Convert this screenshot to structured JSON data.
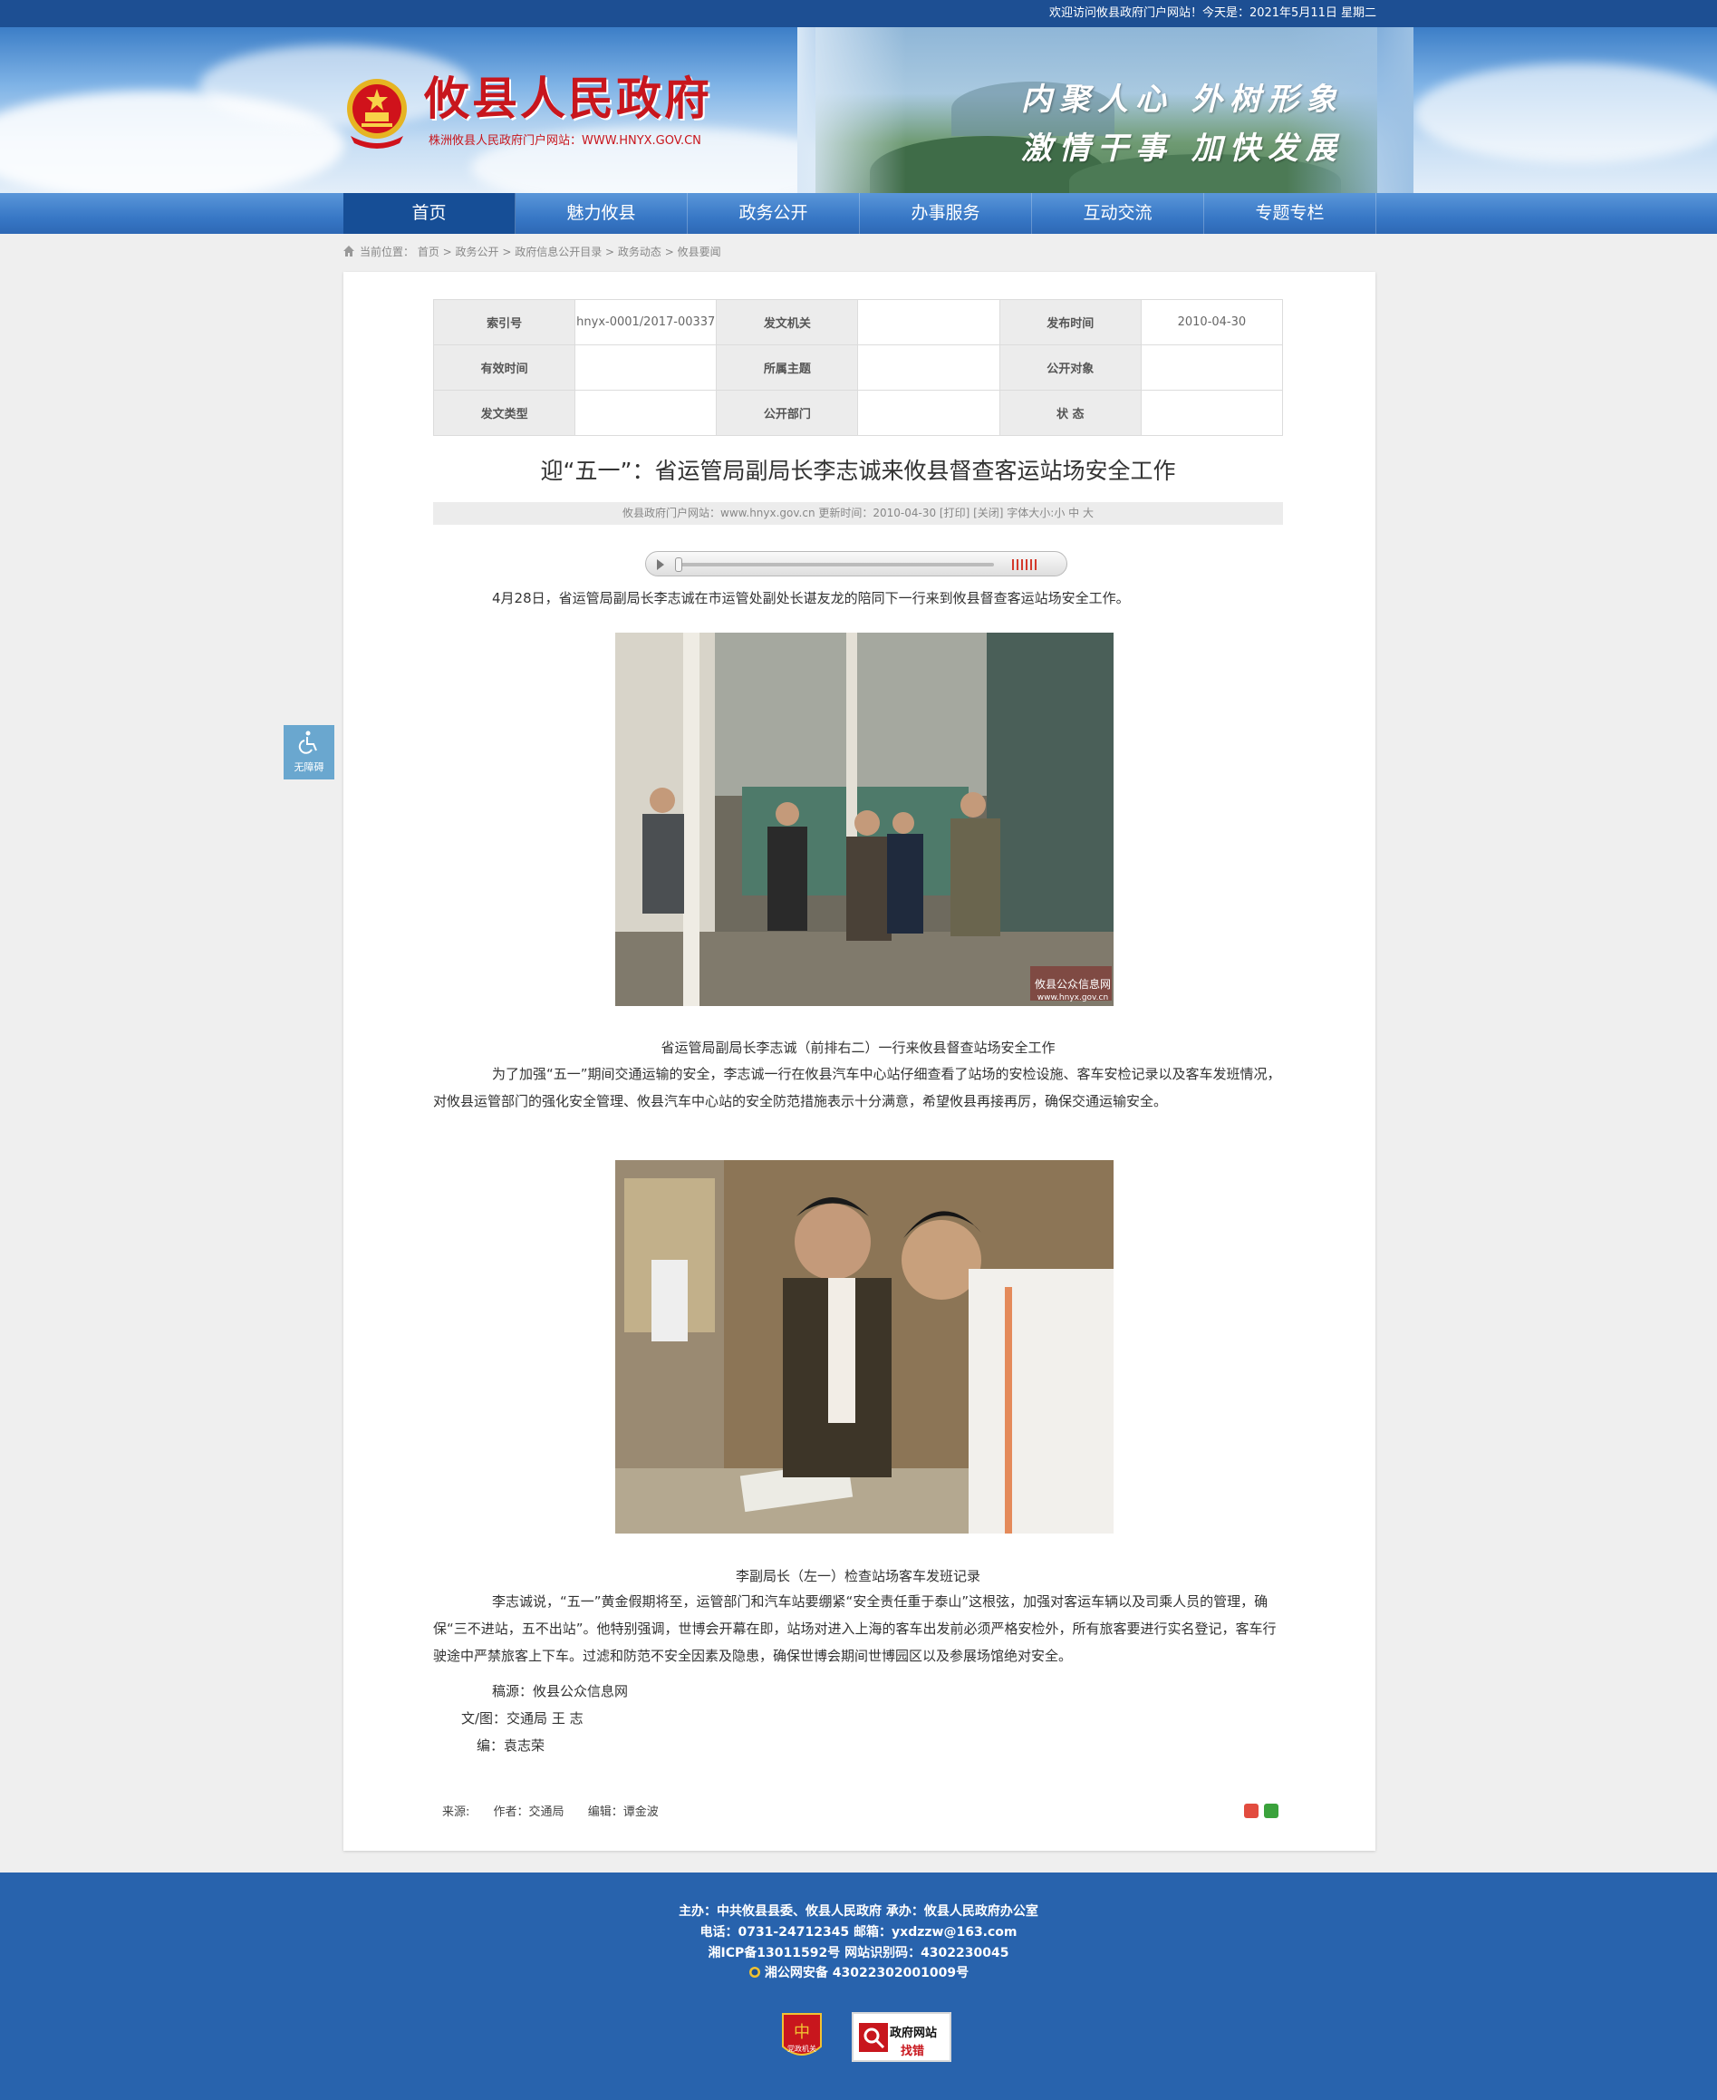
{
  "topbar": {
    "welcome": "欢迎访问攸县政府门户网站！今天是：2021年5月11日 星期二"
  },
  "header": {
    "site_title": "攸县人民政府",
    "site_subtitle": "株洲攸县人民政府门户网站：WWW.HNYX.GOV.CN",
    "slogan_line1": "内聚人心 外树形象",
    "slogan_line2": "激情干事 加快发展"
  },
  "nav": {
    "items": [
      "首页",
      "魅力攸县",
      "政务公开",
      "办事服务",
      "互动交流",
      "专题专栏"
    ],
    "active_index": 0
  },
  "breadcrumb": {
    "label": "当前位置：",
    "path": "首页 > 政务公开 > 政府信息公开目录 > 政务动态 > 攸县要闻"
  },
  "meta_table": {
    "rows": [
      [
        {
          "k": "索引号",
          "v": "hnyx-0001/2017-00337"
        },
        {
          "k": "发文机关",
          "v": ""
        },
        {
          "k": "发布时间",
          "v": "2010-04-30"
        }
      ],
      [
        {
          "k": "有效时间",
          "v": ""
        },
        {
          "k": "所属主题",
          "v": ""
        },
        {
          "k": "公开对象",
          "v": ""
        }
      ],
      [
        {
          "k": "发文类型",
          "v": ""
        },
        {
          "k": "公开部门",
          "v": ""
        },
        {
          "k": "状 态",
          "v": ""
        }
      ]
    ]
  },
  "article": {
    "title": "迎“五一”：省运管局副局长李志诚来攸县督查客运站场安全工作",
    "info": "攸县政府门户网站：www.hnyx.gov.cn   更新时间：2010-04-30  [打印] [关闭]   字体大小:小 中 大",
    "para1": "4月28日，省运管局副局长李志诚在市运管处副处长谌友龙的陪同下一行来到攸县督查客运站场安全工作。",
    "caption1": "省运管局副局长李志诚（前排右二）一行来攸县督查站场安全工作",
    "para2": "为了加强“五一”期间交通运输的安全，李志诚一行在攸县汽车中心站仔细查看了站场的安检设施、客车安检记录以及客车发班情况，对攸县运管部门的强化安全管理、攸县汽车中心站的安全防范措施表示十分满意，希望攸县再接再厉，确保交通运输安全。",
    "caption2": "李副局长（左一）检查站场客车发班记录",
    "para3": "李志诚说，“五一”黄金假期将至，运管部门和汽车站要绷紧“安全责任重于泰山”这根弦，加强对客运车辆以及司乘人员的管理，确保“三不进站，五不出站”。他特别强调，世博会开幕在即，站场对进入上海的客车出发前必须严格安检外，所有旅客要进行实名登记，客车行驶途中严禁旅客上下车。过滤和防范不安全因素及隐患，确保世博会期间世博园区以及参展场馆绝对安全。",
    "source_line": "稿源：攸县公众信息网",
    "author_line": "文/图：交通局   王  志",
    "editor_line": "编：袁志荣",
    "photo_watermark": "攸县公众信息网",
    "photo_watermark_url": "www.hnyx.gov.cn"
  },
  "article_footer": {
    "source": "来源:",
    "author": "作者：交通局",
    "editor": "编辑：谭金波"
  },
  "accessibility": {
    "label": "无障碍"
  },
  "footer": {
    "line1": "主办：中共攸县县委、攸县人民政府 承办：攸县人民政府办公室",
    "line2": "电话：0731-24712345 邮箱：yxdzzw@163.com",
    "line3": "湘ICP备13011592号    网站识别码：4302230045",
    "line4": "湘公网安备 43022302001009号",
    "badge1_label": "党政机关",
    "badge2_line1": "政府网站",
    "badge2_line2": "找错"
  },
  "colors": {
    "brand_blue": "#2863ad",
    "title_red": "#c8161d",
    "nav_active": "#164e96"
  }
}
